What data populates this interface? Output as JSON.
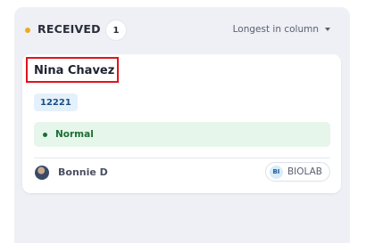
{
  "column": {
    "title": "RECEIVED",
    "count": "1",
    "sort_label": "Longest in column",
    "status_color": "#f0a81c"
  },
  "card": {
    "name": "Nina Chavez",
    "id": "12221",
    "priority": "Normal",
    "priority_color": "#1c6e35",
    "assignee": "Bonnie D",
    "lab": {
      "initials": "BI",
      "name": "BIOLAB"
    }
  }
}
